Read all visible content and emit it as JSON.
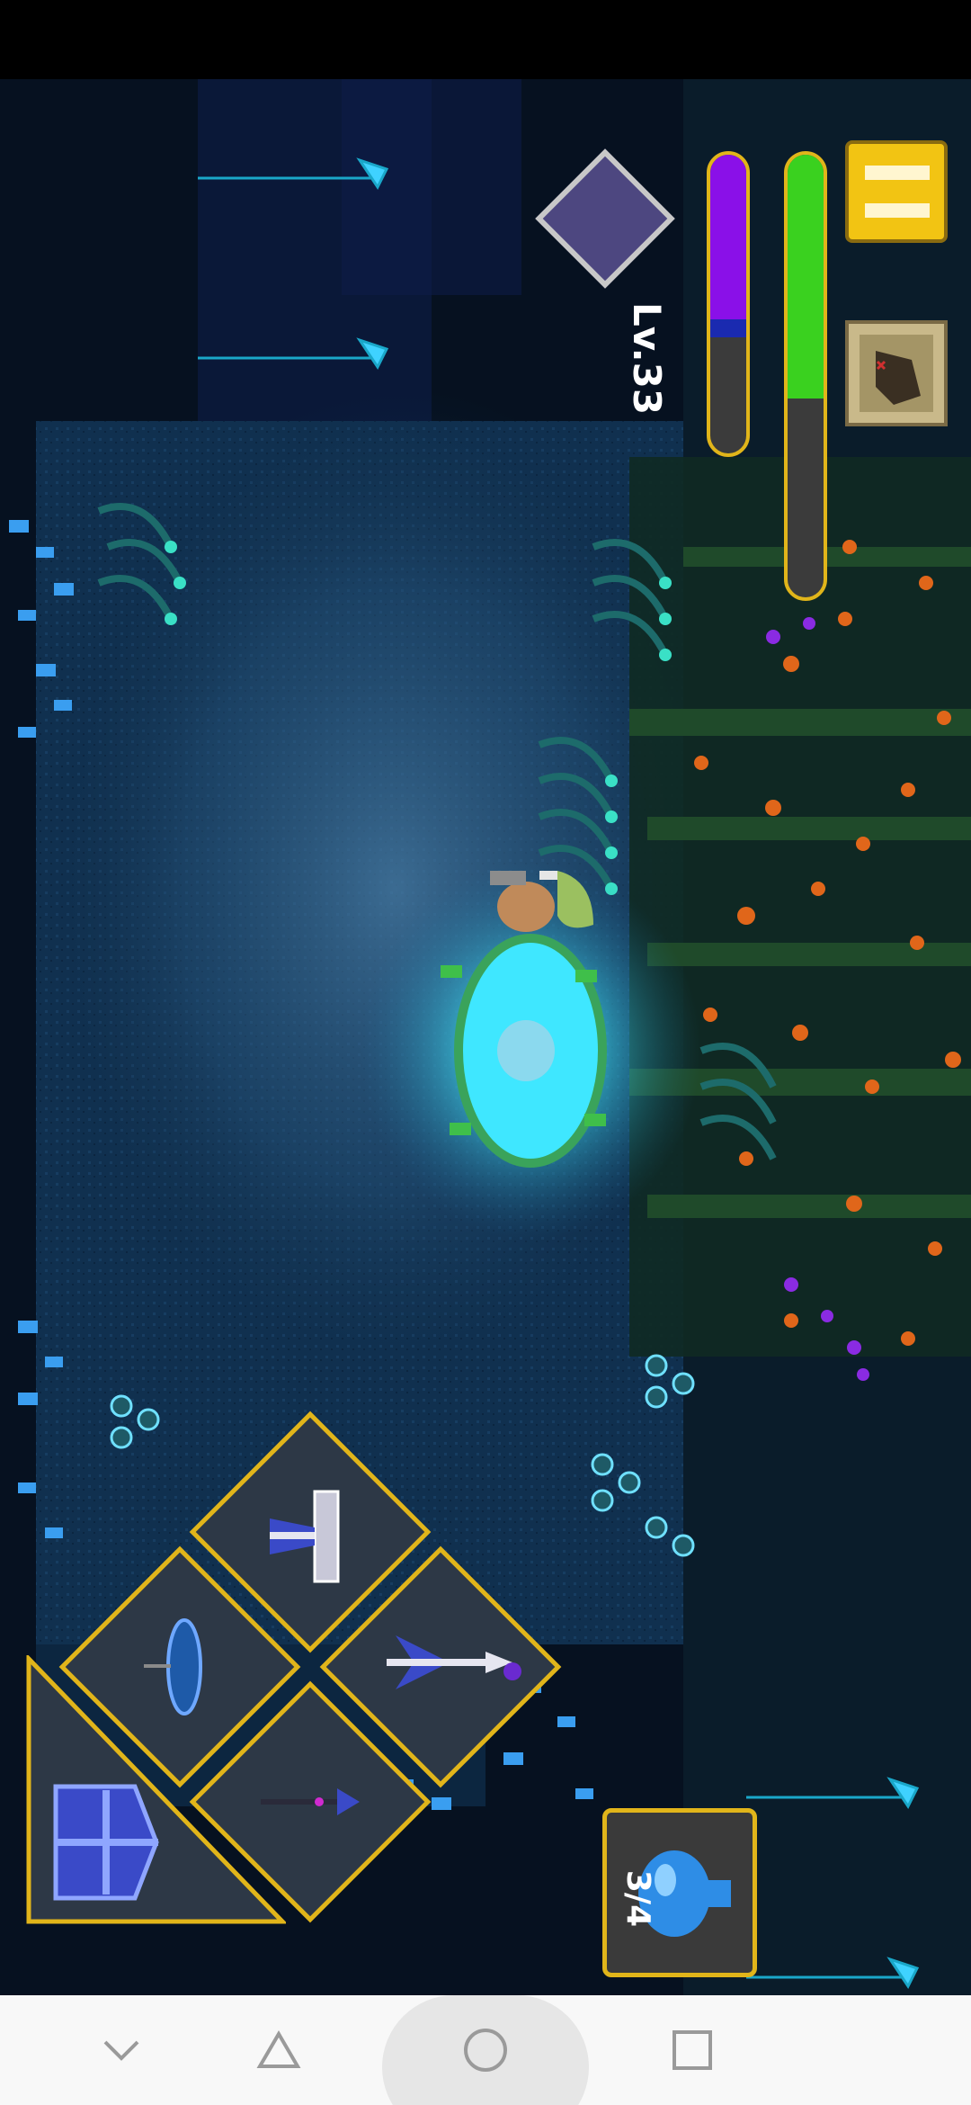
{
  "hud": {
    "level": "Lv.33",
    "potion_count": "3/4",
    "health_fill": 0.55,
    "mana_fill": 0.55
  },
  "skills": {
    "slots": [
      "hammer-skill-icon",
      "spear-skill-icon",
      "staff-skill-icon",
      "harpoon-skill-icon"
    ]
  },
  "navbar": {
    "buttons": [
      "chevron-down-icon",
      "back-triangle-icon",
      "home-circle-icon",
      "recents-square-icon"
    ]
  },
  "colors": {
    "health": "#3ad11f",
    "mana": "#8a10e8",
    "frame_gold": "#e1b51a",
    "pause": "#f2c413",
    "portal": "#3fe7ff"
  }
}
